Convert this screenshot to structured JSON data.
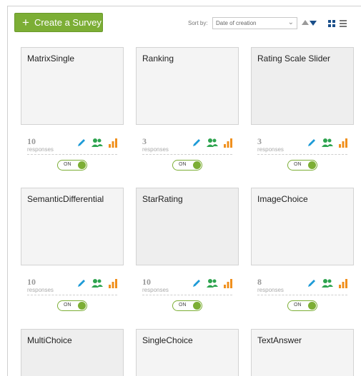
{
  "toolbar": {
    "create_label": "Create a Survey",
    "sort_label": "Sort by:",
    "sort_value": "Date of creation"
  },
  "colors": {
    "accent_green": "#7cae35",
    "edit_icon": "#1e9bd7",
    "users_icon": "#2ea44f",
    "stats_icon": "#f0901e"
  },
  "surveys": [
    {
      "title": "MatrixSingle",
      "count": "10",
      "responses_label": "responses",
      "toggle": "ON"
    },
    {
      "title": "Ranking",
      "count": "3",
      "responses_label": "responses",
      "toggle": "ON"
    },
    {
      "title": "Rating Scale Slider",
      "count": "3",
      "responses_label": "responses",
      "toggle": "ON"
    },
    {
      "title": "SemanticDifferential",
      "count": "10",
      "responses_label": "responses",
      "toggle": "ON"
    },
    {
      "title": "StarRating",
      "count": "10",
      "responses_label": "responses",
      "toggle": "ON"
    },
    {
      "title": "ImageChoice",
      "count": "8",
      "responses_label": "responses",
      "toggle": "ON"
    },
    {
      "title": "MultiChoice"
    },
    {
      "title": "SingleChoice"
    },
    {
      "title": "TextAnswer"
    }
  ]
}
